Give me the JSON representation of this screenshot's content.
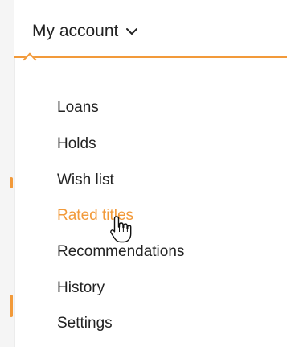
{
  "account_menu": {
    "toggle_label": "My account",
    "items": [
      {
        "label": "Loans"
      },
      {
        "label": "Holds"
      },
      {
        "label": "Wish list"
      },
      {
        "label": "Rated titles"
      },
      {
        "label": "Recommendations"
      },
      {
        "label": "History"
      },
      {
        "label": "Settings"
      }
    ],
    "active_item": "Rated titles"
  },
  "colors": {
    "accent": "#f29a3a",
    "text": "#222222",
    "background": "#ffffff"
  },
  "icons": {
    "toggle_icon": "chevron-down-icon",
    "pointer": "hand-pointer-icon"
  }
}
